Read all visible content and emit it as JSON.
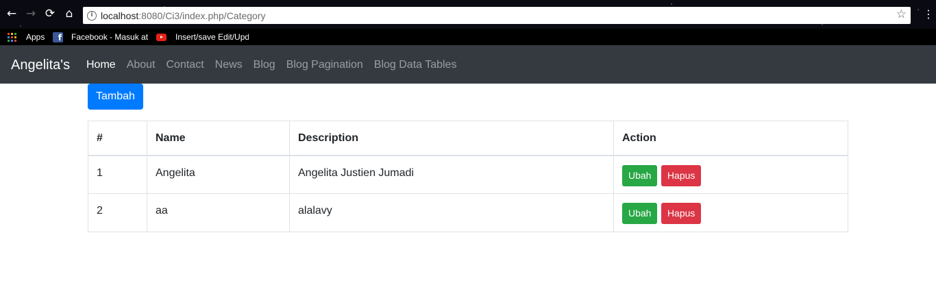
{
  "browser": {
    "url_host": "localhost",
    "url_rest": ":8080/Ci3/index.php/Category",
    "bookmarks": [
      {
        "label": "Apps"
      },
      {
        "label": "Facebook - Masuk at"
      },
      {
        "label": "Insert/save Edit/Upd"
      }
    ]
  },
  "navbar": {
    "brand": "Angelita's",
    "links": [
      "Home",
      "About",
      "Contact",
      "News",
      "Blog",
      "Blog Pagination",
      "Blog Data Tables"
    ]
  },
  "main": {
    "add_button": "Tambah",
    "table": {
      "headers": [
        "#",
        "Name",
        "Description",
        "Action"
      ],
      "rows": [
        {
          "num": "1",
          "name": "Angelita",
          "description": "Angelita Justien Jumadi",
          "edit": "Ubah",
          "delete": "Hapus"
        },
        {
          "num": "2",
          "name": "aa",
          "description": "alalavy",
          "edit": "Ubah",
          "delete": "Hapus"
        }
      ]
    }
  },
  "colors": {
    "navbar_bg": "#343a40",
    "primary": "#007bff",
    "success": "#28a745",
    "danger": "#dc3545"
  }
}
